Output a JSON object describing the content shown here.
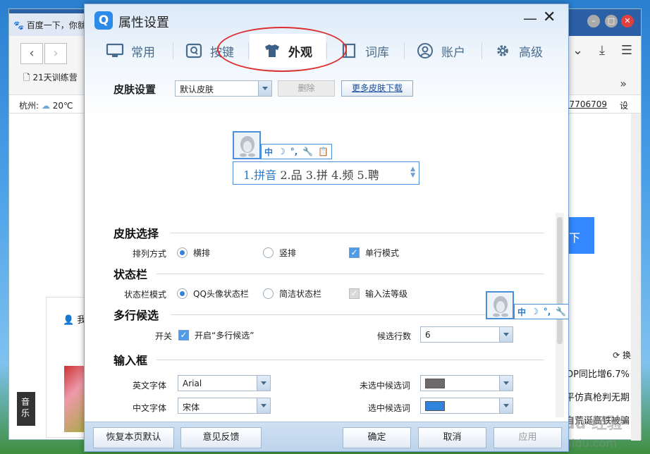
{
  "background": {
    "tab_title": "百度一下，你就",
    "bookmark": "21天训练营",
    "location": "杭州:",
    "temperature": "20℃",
    "phone_fragment": "47706709",
    "setting_link": "设",
    "search_btn_fragment": "下",
    "panel_fragment": "我",
    "music_label": "音乐",
    "news": [
      "GDP同比增6.7%",
      "平仿真枪判无期",
      "自荒诞高铁被骗"
    ],
    "refresh_label": "换",
    "watermark": "Baidu 经验",
    "watermark_url": "jingyan.baidu.com"
  },
  "dialog": {
    "logo": "Q",
    "title": "属性设置",
    "minimize": "—",
    "close": "✕"
  },
  "tabs": [
    {
      "label": "常用",
      "icon": "monitor-icon"
    },
    {
      "label": "按键",
      "icon": "key-icon"
    },
    {
      "label": "外观",
      "icon": "tshirt-icon",
      "active": true
    },
    {
      "label": "词库",
      "icon": "book-icon"
    },
    {
      "label": "账户",
      "icon": "user-icon"
    },
    {
      "label": "高级",
      "icon": "gear-icon"
    }
  ],
  "skin": {
    "label": "皮肤设置",
    "selected": "默认皮肤",
    "delete": "删除",
    "more": "更多皮肤下载"
  },
  "preview": {
    "status_items": [
      "中",
      "☽",
      "°,",
      "🔧",
      "📋"
    ],
    "candidates": [
      "1.拼音",
      "2.品",
      "3.拼",
      "4.频",
      "5.聘"
    ]
  },
  "sections": {
    "skin_select": {
      "title": "皮肤选择",
      "arrange_label": "排列方式",
      "horizontal": "横排",
      "vertical": "竖排",
      "single_line": "单行模式"
    },
    "status_bar": {
      "title": "状态栏",
      "mode_label": "状态栏模式",
      "qq_avatar": "QQ头像状态栏",
      "simple": "简洁状态栏",
      "level": "输入法等级"
    },
    "multi_candidate": {
      "title": "多行候选",
      "switch_label": "开关",
      "enable": "开启“多行候选”",
      "rows_label": "候选行数",
      "rows_value": "6"
    },
    "input_box": {
      "title": "输入框",
      "en_font_label": "英文字体",
      "en_font": "Arial",
      "zh_font_label": "中文字体",
      "zh_font": "宋体",
      "unselected_label": "未选中候选词",
      "selected_label": "选中候选词",
      "unselected_color": "#6e6a6a",
      "selected_color": "#2f84dc"
    }
  },
  "footer": {
    "restore": "恢复本页默认",
    "feedback": "意见反馈",
    "ok": "确定",
    "cancel": "取消",
    "apply": "应用"
  }
}
